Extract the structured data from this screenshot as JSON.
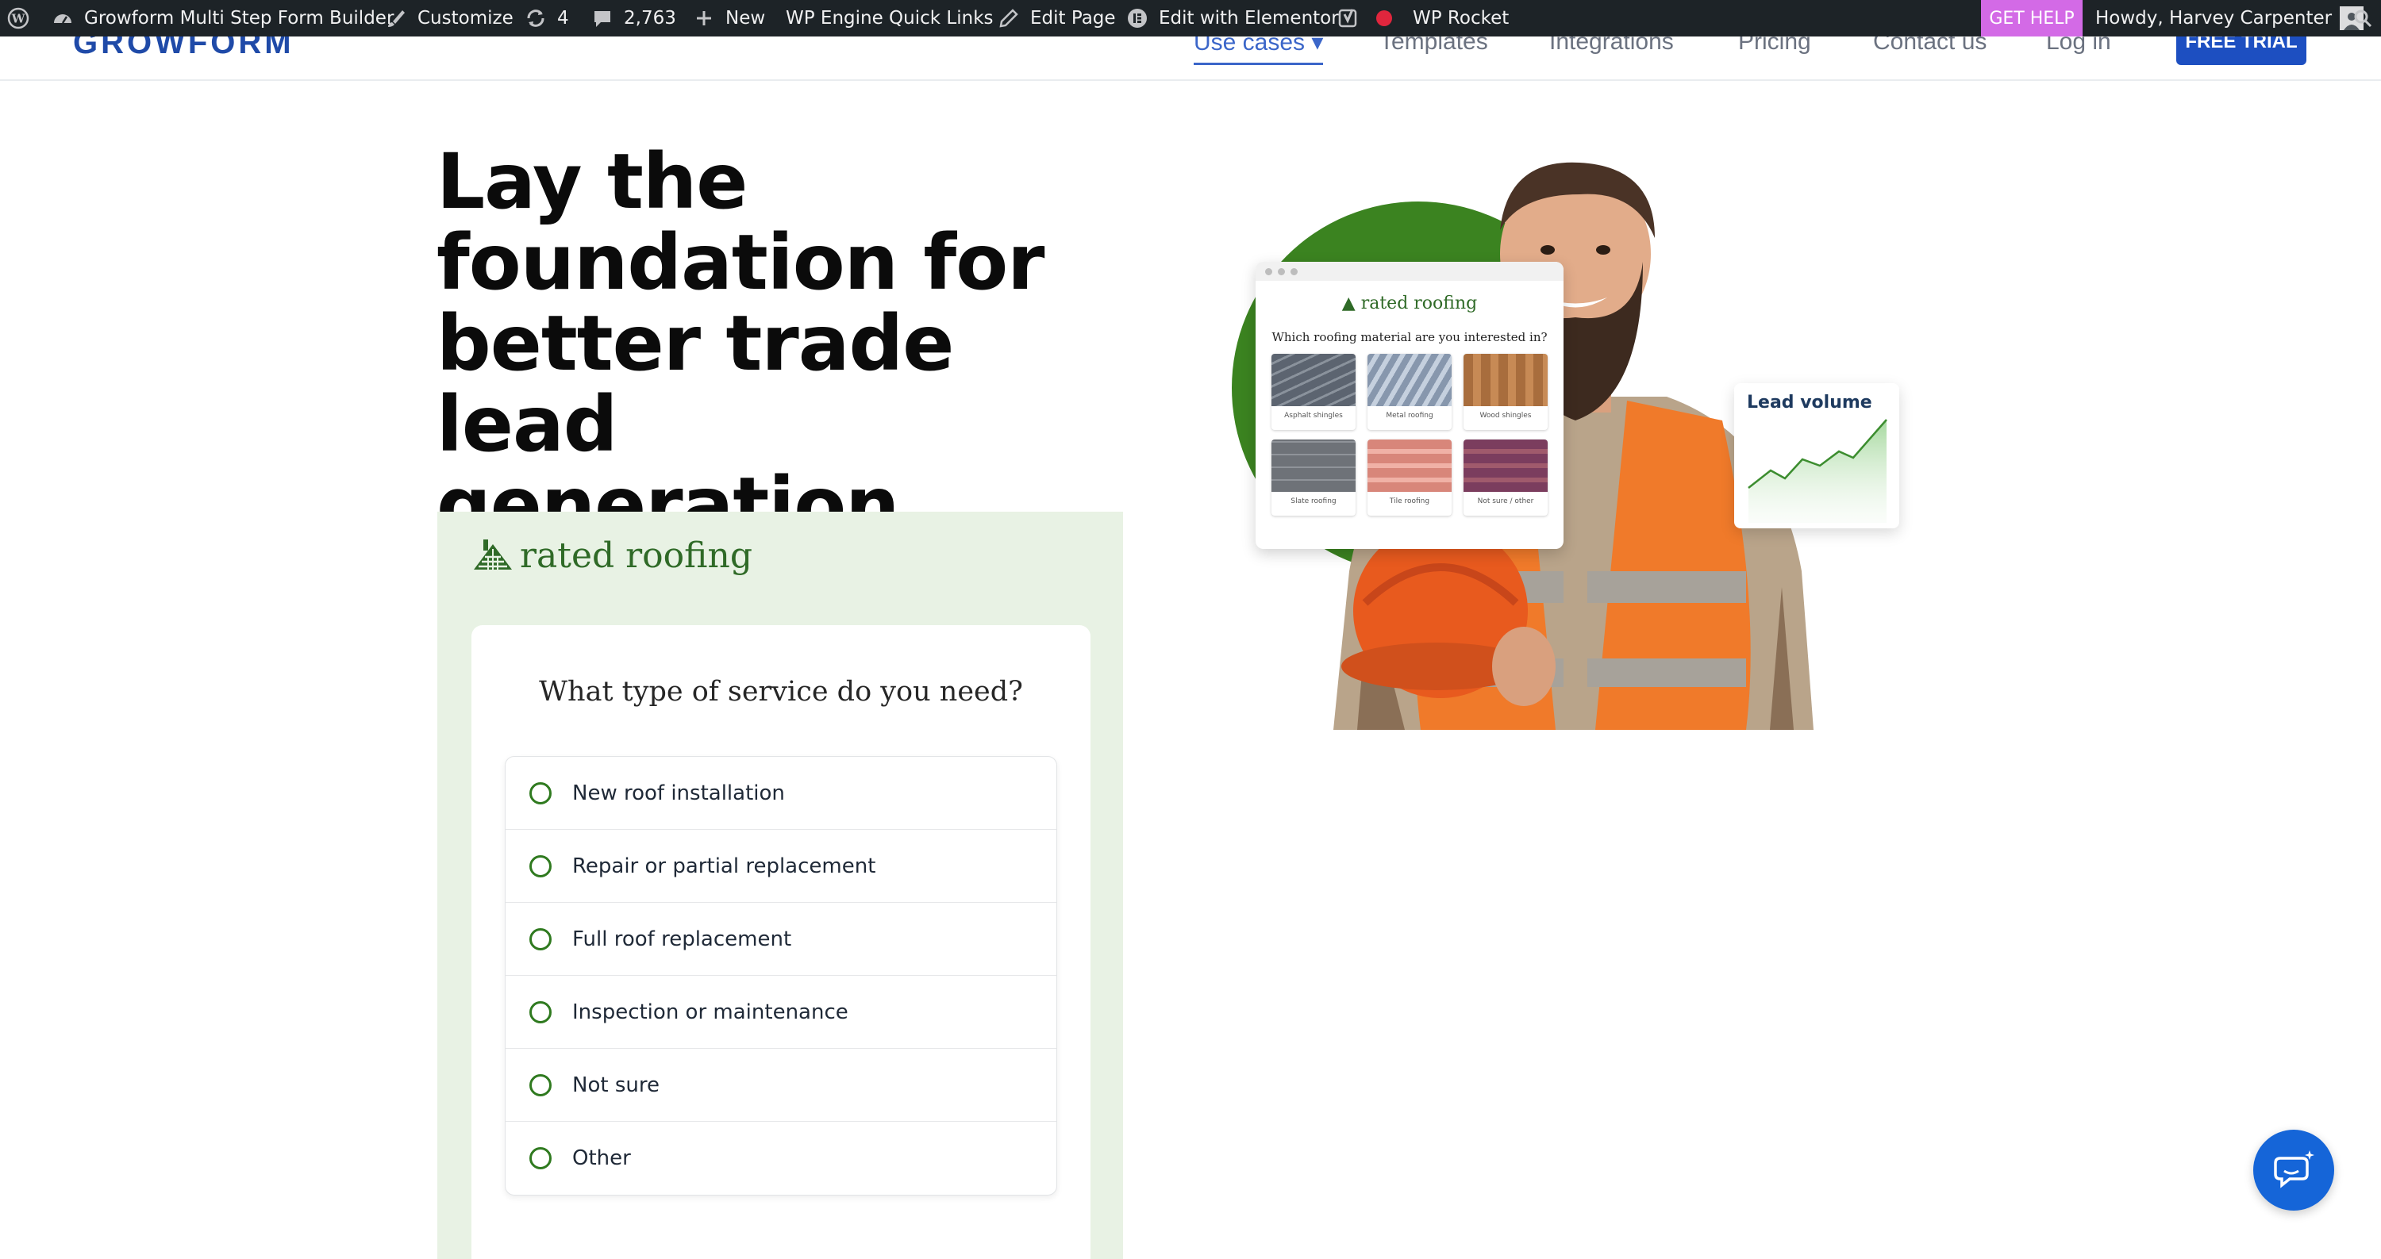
{
  "adminbar": {
    "site_name": "Growform Multi Step Form Builder",
    "customize": "Customize",
    "updates_count": "4",
    "comments_count": "2,763",
    "new_label": "New",
    "wp_engine": "WP Engine Quick Links",
    "edit_page": "Edit Page",
    "elementor": "Edit with Elementor",
    "wp_rocket": "WP Rocket",
    "get_help": "GET HELP",
    "howdy": "Howdy, Harvey Carpenter"
  },
  "header": {
    "brand": "GROWFORM",
    "nav": [
      "Use cases",
      "Templates",
      "Integrations",
      "Pricing",
      "Contact us",
      "Log in"
    ],
    "cta": "FREE TRIAL"
  },
  "hero": {
    "headline_lines": [
      "Lay the",
      "foundation for",
      "better trade lead",
      "generation"
    ]
  },
  "form": {
    "logo_text": "rated roofing",
    "question": "What type of service do you need?",
    "options": [
      "New roof installation",
      "Repair or partial replacement",
      "Full roof replacement",
      "Inspection or maintenance",
      "Not sure",
      "Other"
    ]
  },
  "mockup": {
    "logo_text": "rated roofing",
    "question": "Which roofing material are you interested in?",
    "tiles": [
      "Asphalt shingles",
      "Metal roofing",
      "Wood shingles",
      "Slate roofing",
      "Tile roofing",
      "Not sure / other"
    ],
    "lead_title": "Lead volume"
  },
  "colors": {
    "brand_blue": "#1d4fc1",
    "form_green": "#2f6a27",
    "panel_bg": "#e8f2e4",
    "get_help": "#d36ae6"
  }
}
